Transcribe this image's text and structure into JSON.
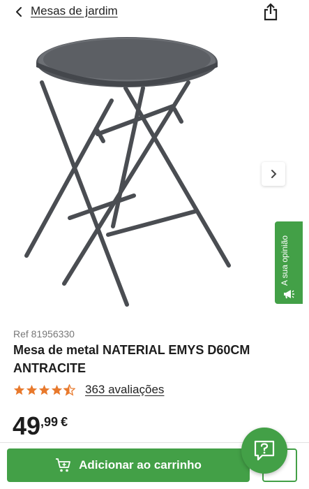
{
  "header": {
    "back_icon": "chevron-left-icon",
    "breadcrumb": "Mesas de jardim",
    "share_icon": "share-icon"
  },
  "product": {
    "image_alt": "round folding metal bistro table",
    "ref": "Ref 81956330",
    "title": "Mesa de metal NATERIAL EMYS D60CM ANTRACITE",
    "rating": 4.5,
    "reviews": "363 avaliações",
    "price_int": "49",
    "price_dec": ",99",
    "currency": "€"
  },
  "gallery": {
    "next_icon": "chevron-right-icon"
  },
  "feedback": {
    "label": "A sua opinião",
    "icon": "megaphone-icon"
  },
  "actions": {
    "add_to_cart": "Adicionar ao carrinho",
    "cart_icon": "cart-icon",
    "help_icon": "help-chat-icon"
  },
  "colors": {
    "accent": "#43a047",
    "star": "#e8792c",
    "table": "#4a4d52"
  }
}
